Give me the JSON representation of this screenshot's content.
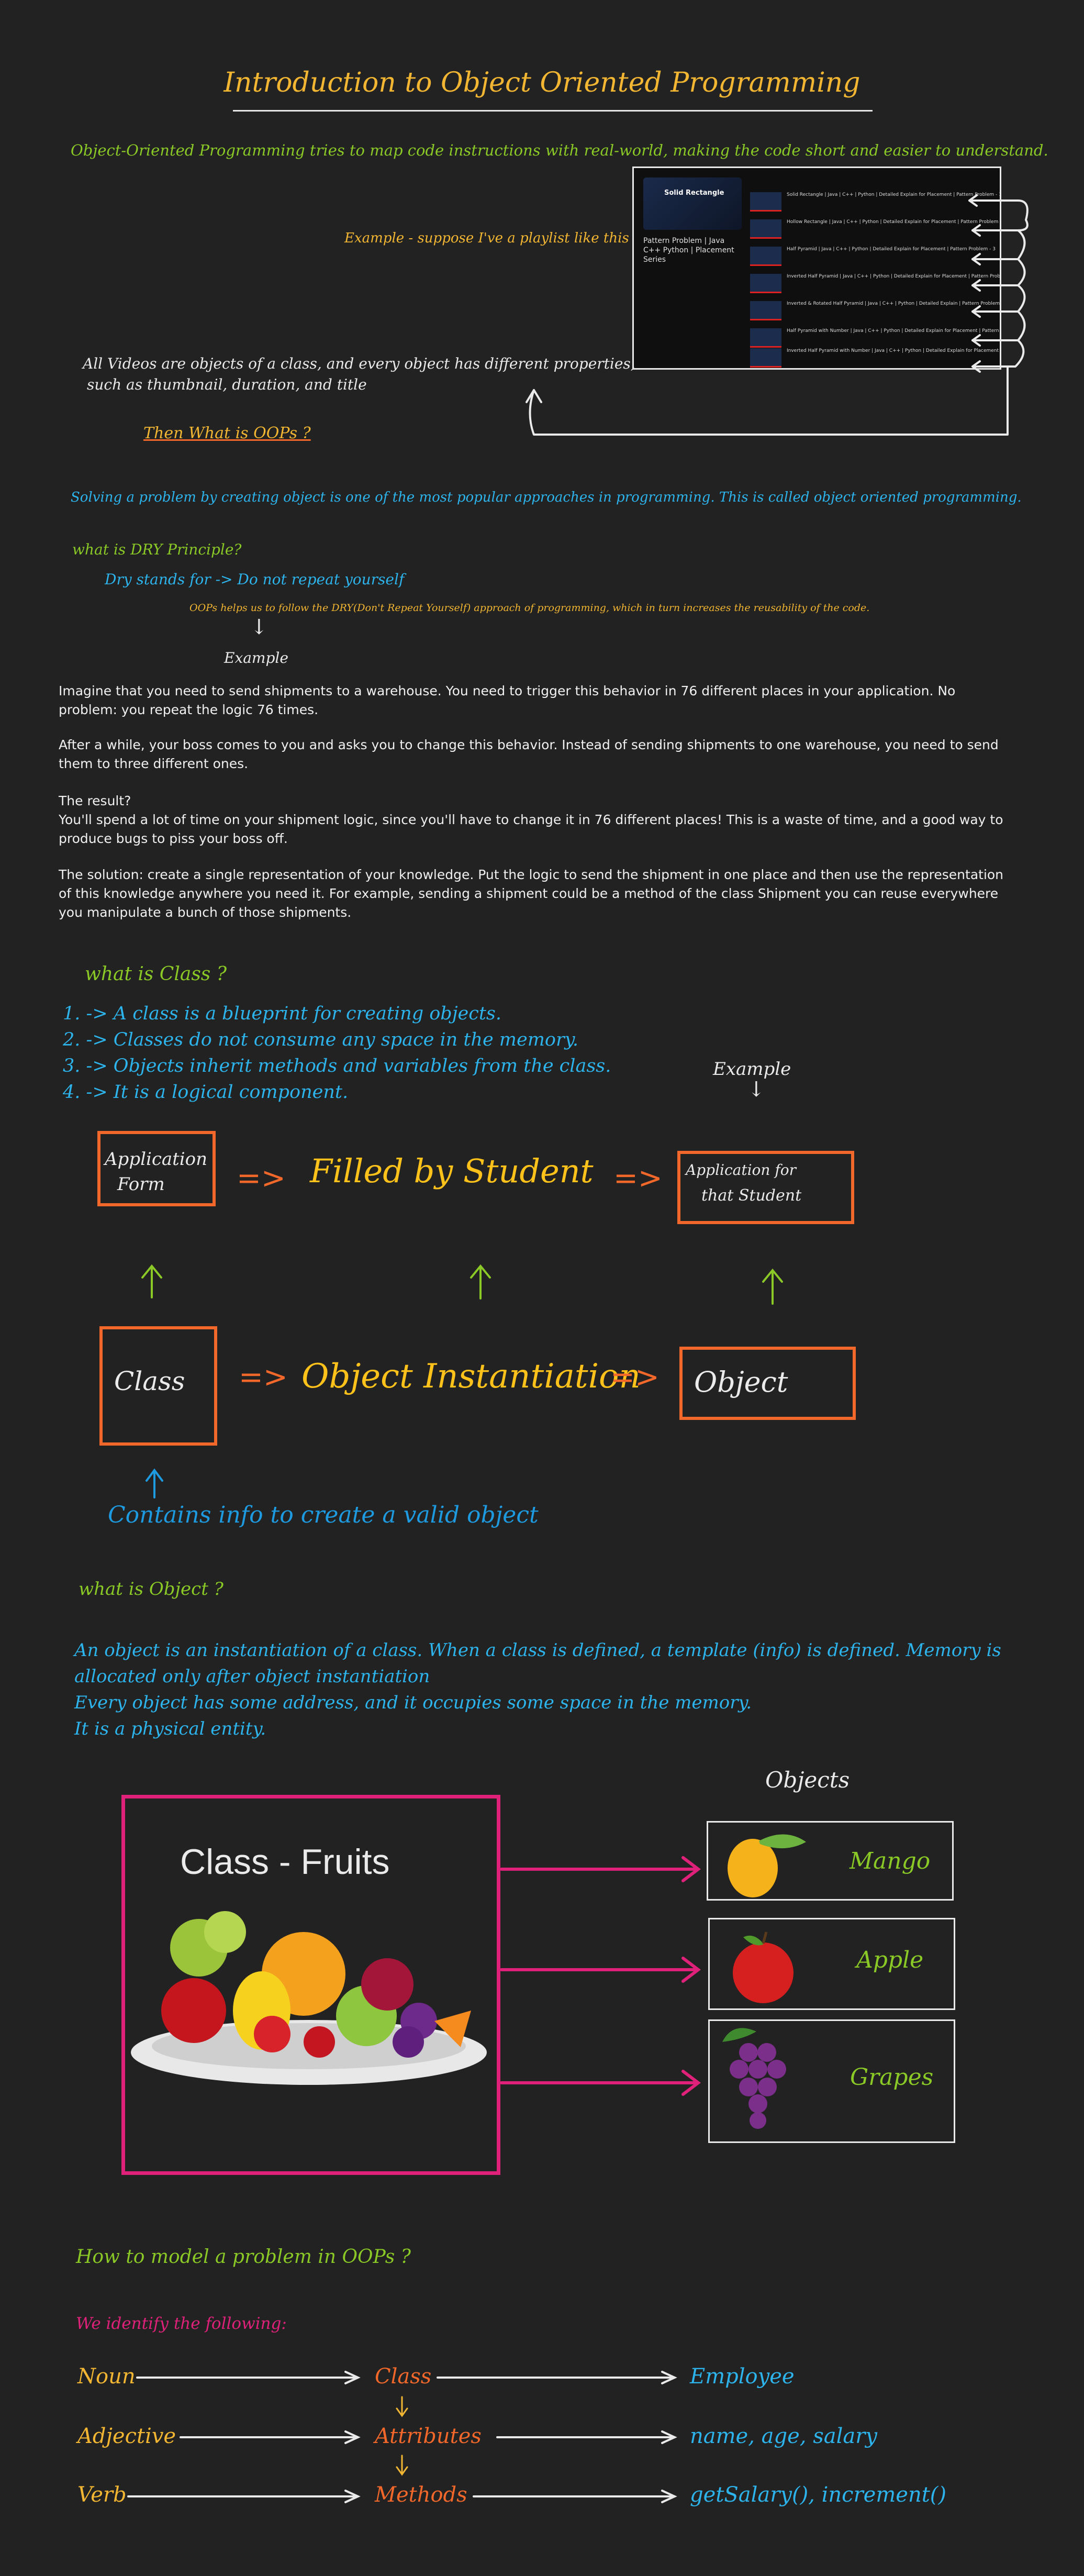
{
  "title": "Introduction to Object Oriented Programming",
  "intro": "Object-Oriented Programming tries to map code instructions with real-world, making the code short and easier to understand.",
  "example_note": "Example - suppose I've a playlist like this",
  "videos_note_line1": "All Videos are objects of a class, and every object has different properties,",
  "videos_note_line2": "such as thumbnail, duration, and title",
  "then_oops": "Then What is OOPs ?",
  "solving": "Solving a problem by creating object is one of the most popular approaches in programming. This is called object oriented programming.",
  "playlist": {
    "cover_title": "Solid Rectangle",
    "left_title": "Pattern Problem | Java C++ Python | Placement Series",
    "items": [
      "Solid Rectangle | Java | C++ | Python | Detailed Explain for Placement | Pattern Problem - 1",
      "Hollow Rectangle | Java | C++ | Python | Detailed Explain for Placement | Pattern Problem - 2",
      "Half Pyramid | Java | C++ | Python | Detailed Explain for Placement | Pattern Problem - 3",
      "Inverted Half Pyramid | Java | C++ | Python | Detailed Explain for Placement | Pattern Problem - 4",
      "Inverted & Rotated Half Pyramid | Java | C++ | Python | Detailed Explain | Pattern Problem - 5",
      "Half Pyramid with Number | Java | C++ | Python | Detailed Explain for Placement | Pattern Problem - 6",
      "Inverted Half Pyramid with Number | Java | C++ | Python | Detailed Explain for Placement | Pattern Problem - 7"
    ]
  },
  "dry": {
    "question": "what is DRY Principle?",
    "stands": "Dry stands for -> Do not repeat yourself",
    "helps": "OOPs helps us to follow the DRY(Don't Repeat Yourself) approach of programming, which in turn increases the reusability of the code.",
    "example": "Example"
  },
  "paragraphs": [
    "Imagine that you need to send shipments to a warehouse. You need to trigger this behavior in 76 different places in your application. No problem: you repeat the logic 76 times.",
    "After a while, your boss comes to you and asks you to change this behavior. Instead of sending shipments to one warehouse, you need to send them to three different ones.",
    "The result?\n You'll spend a lot of time on your shipment logic, since you'll have to change it in 76 different places! This is a waste of time, and a good way to produce bugs to piss your boss off.",
    "The solution: create a single representation of your knowledge. Put the logic to send the shipment in one place and then use the representation of this knowledge anywhere you need it. For example, sending a shipment could be a method of the class Shipment you can reuse everywhere you manipulate a bunch of those shipments."
  ],
  "class_section": {
    "question": "what is Class ?",
    "points": [
      "1. -> A class is a blueprint for creating objects.",
      "2. -> Classes do not consume any space in the memory.",
      "3. -> Objects inherit methods and variables from the class.",
      "4. -> It is a logical component."
    ],
    "example": "Example"
  },
  "diagram": {
    "app_form_line1": "Application",
    "app_form_line2": "Form",
    "filled": "Filled by Student",
    "app_student_line1": "Application for",
    "app_student_line2": "that Student",
    "class": "Class",
    "instantiation": "Object Instantiation",
    "object": "Object",
    "contains": "Contains info to create a valid object",
    "arrow": "=>"
  },
  "object_section": {
    "question": "what is Object ?",
    "lines": [
      "An object is an instantiation of a class. When a class is defined, a template (info) is defined. Memory is",
      "allocated only after object instantiation",
      "Every object has some address, and it occupies some space in the memory.",
      "It is a physical entity."
    ]
  },
  "fruits": {
    "objects_heading": "Objects",
    "class_label": "Class - Fruits",
    "items": [
      "Mango",
      "Apple",
      "Grapes"
    ]
  },
  "model": {
    "question": "How to model a problem in OOPs ?",
    "identify": "We identify the following:",
    "rows": [
      {
        "left": "Noun",
        "mid": "Class",
        "right": "Employee"
      },
      {
        "left": "Adjective",
        "mid": "Attributes",
        "right": "name, age, salary"
      },
      {
        "left": "Verb",
        "mid": "Methods",
        "right": "getSalary(), increment()"
      }
    ]
  },
  "colors": {
    "background": "#222222",
    "green": "#8ac926",
    "yellow": "#f2b632",
    "orange": "#f2672a",
    "blue": "#2db4ec",
    "magenta": "#e0217a"
  }
}
